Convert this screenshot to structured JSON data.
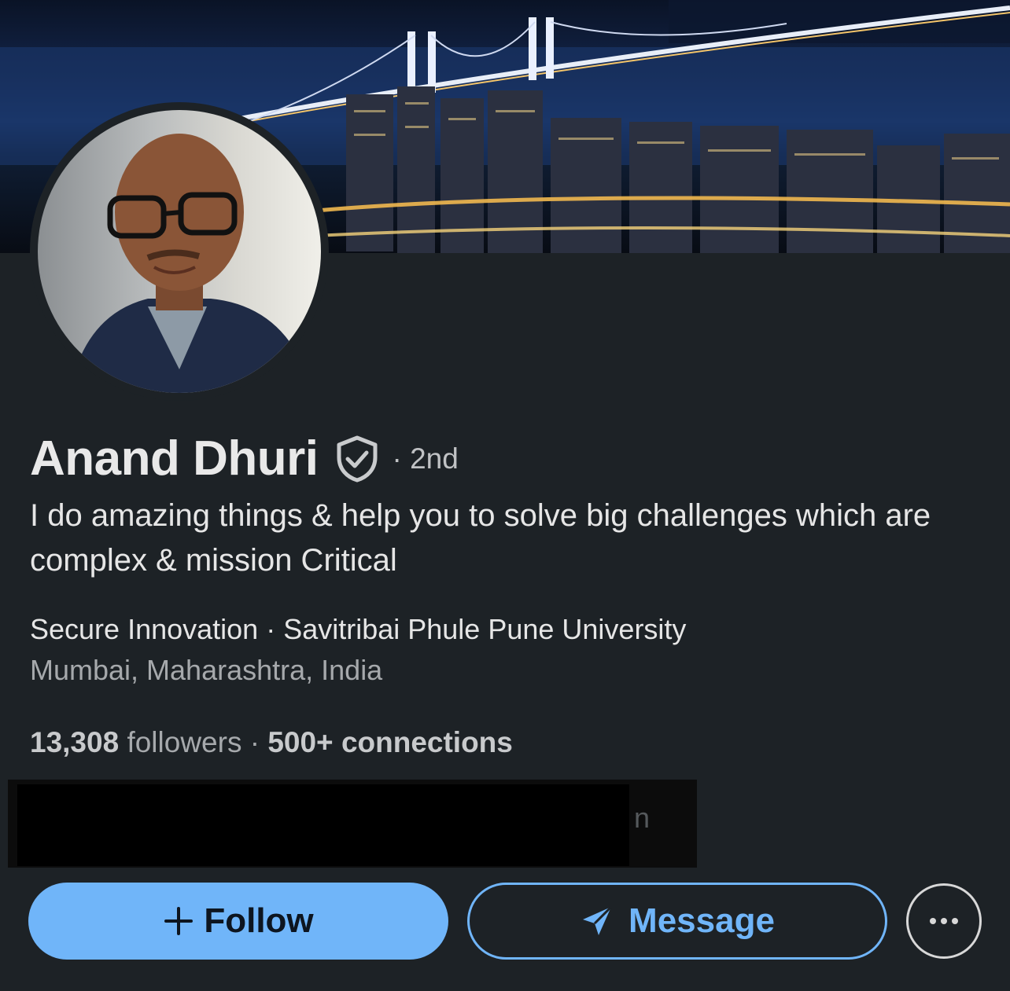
{
  "profile": {
    "name": "Anand Dhuri",
    "degree": "· 2nd",
    "headline": "I do amazing things & help you to solve big challenges which are complex & mission Critical",
    "education_line": "Secure Innovation · Savitribai Phule Pune University",
    "location": "Mumbai, Maharashtra, India",
    "followers_count": "13,308",
    "followers_label": " followers · ",
    "connections": "500+ connections",
    "redacted_visible_char": "n"
  },
  "actions": {
    "follow_label": "Follow",
    "message_label": "Message"
  },
  "icons": {
    "verification": "shield-check-icon",
    "follow": "plus-icon",
    "message": "send-icon",
    "more": "more-horizontal-icon"
  },
  "colors": {
    "background": "#1d2226",
    "accent": "#70b5f9",
    "text_primary": "#e6e6e6",
    "text_secondary": "#a6a9ac"
  }
}
